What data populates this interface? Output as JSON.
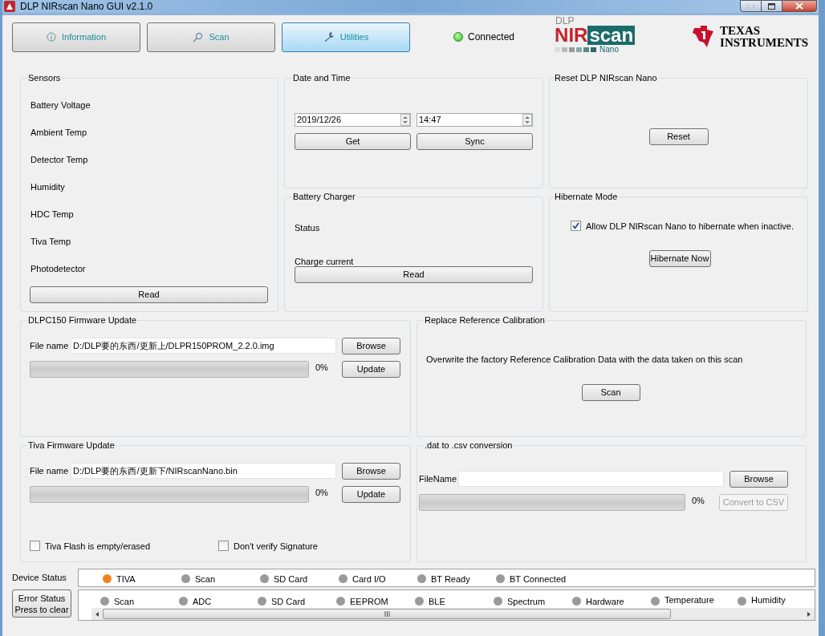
{
  "window": {
    "title": "DLP NIRscan Nano GUI v2.1.0"
  },
  "tabs": [
    {
      "label": "Information",
      "kind": "info",
      "selected": false
    },
    {
      "label": "Scan",
      "kind": "search",
      "selected": false
    },
    {
      "label": "Utilities",
      "kind": "wrench",
      "selected": true
    }
  ],
  "connection": {
    "label": "Connected",
    "connected": true
  },
  "logos": {
    "nirscan": [
      "DLP",
      "NIR",
      "scan",
      "Nano"
    ],
    "ti": [
      "TEXAS",
      "INSTRUMENTS"
    ]
  },
  "sensors": {
    "title": "Sensors",
    "labels": [
      "Battery Voltage",
      "Ambient Temp",
      "Detector Temp",
      "Humidity",
      "HDC Temp",
      "Tiva Temp",
      "Photodetector"
    ],
    "button": "Read"
  },
  "date_time": {
    "title": "Date and Time",
    "date": "2019/12/26",
    "time": "14:47",
    "buttons": [
      "Get",
      "Sync"
    ]
  },
  "battery_charger": {
    "title": "Battery Charger",
    "labels": [
      "Status",
      "Charge current"
    ],
    "button": "Read"
  },
  "reset": {
    "title": "Reset DLP NIRscan Nano",
    "button": "Reset"
  },
  "hibernate": {
    "title": "Hibernate Mode",
    "checkbox": {
      "label": "Allow DLP NIRscan Nano to hibernate when inactive.",
      "checked": true
    },
    "button": "Hibernate Now"
  },
  "dlpc_update": {
    "title": "DLPC150 Firmware Update",
    "file_label": "File name",
    "file_value": "D:/DLP要的东西/更新上/DLPR150PROM_2.2.0.img",
    "level": 0,
    "percent": "0%",
    "buttons": [
      "Browse",
      "Update"
    ]
  },
  "calibration": {
    "title": "Replace Reference Calibration",
    "description": "Overwrite the factory Reference Calibration Data with the data taken on this scan",
    "button": "Scan"
  },
  "tiva_update": {
    "title": "Tiva Firmware Update",
    "file_label": "File name",
    "file_value": "D:/DLP要的东西/更新下/NIRscanNano.bin",
    "level": 0,
    "percent": "0%",
    "buttons": [
      "Browse",
      "Update"
    ],
    "checkboxes": [
      {
        "label": "Tiva Flash is empty/erased",
        "checked": false
      },
      {
        "label": "Don't verify Signature",
        "checked": false
      }
    ]
  },
  "conversion": {
    "title": ".dat to .csv conversion",
    "file_label": "FileName",
    "level": 0,
    "percent": "0%",
    "buttons": [
      {
        "label": "Browse",
        "disabled": false
      },
      {
        "label": "Convert to CSV",
        "disabled": true
      }
    ]
  },
  "device_status": {
    "label": "Device Status",
    "items": [
      {
        "label": "TIVA",
        "color": "#f5821f"
      },
      {
        "label": "Scan",
        "color": "#9a9a9a"
      },
      {
        "label": "SD Card",
        "color": "#9a9a9a"
      },
      {
        "label": "Card I/O",
        "color": "#9a9a9a"
      },
      {
        "label": "BT Ready",
        "color": "#9a9a9a"
      },
      {
        "label": "BT Connected",
        "color": "#9a9a9a"
      }
    ]
  },
  "error_status": {
    "button": [
      "Error Status",
      "Press to clear"
    ],
    "items": [
      {
        "label": "Scan",
        "color": "#9a9a9a"
      },
      {
        "label": "ADC",
        "color": "#9a9a9a"
      },
      {
        "label": "SD Card",
        "color": "#9a9a9a"
      },
      {
        "label": "EEPROM",
        "color": "#9a9a9a"
      },
      {
        "label": "BLE",
        "color": "#9a9a9a"
      },
      {
        "label": "Spectrum",
        "color": "#9a9a9a"
      },
      {
        "label": "Hardware",
        "color": "#9a9a9a"
      },
      {
        "label": "Temperature",
        "color": "#9a9a9a"
      },
      {
        "label": "Humidity",
        "color": "#9a9a9a"
      }
    ]
  }
}
